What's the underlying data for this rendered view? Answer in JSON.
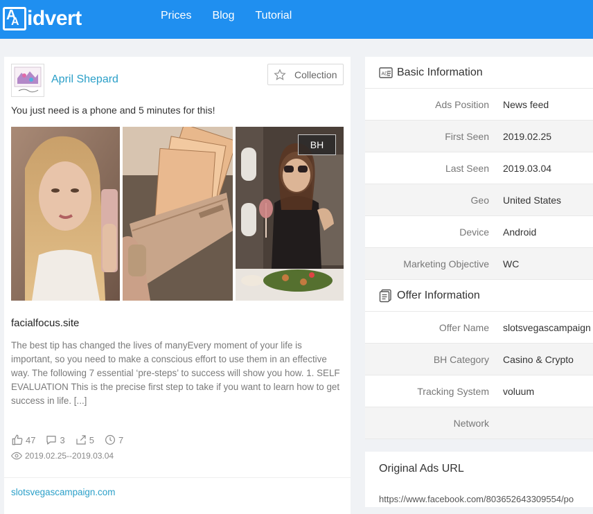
{
  "brand": {
    "logo_text": "idvert",
    "accent": "#1f8ff0",
    "link_color": "#2a9fc8"
  },
  "nav": {
    "items": [
      "Prices",
      "Blog",
      "Tutorial"
    ]
  },
  "ad": {
    "author": "April Shepard",
    "collection_label": "Collection",
    "caption": "You just need is a phone and 5 minutes for this!",
    "badge": "BH",
    "site": "facialfocus.site",
    "description": "The best tip has changed the lives of manyEvery moment of your life is important, so you need to make a conscious effort to use them in an effective way. The following 7 essential ‘pre-steps’ to success will show you how. 1. SELF EVALUATION This is the precise first step to take if you want to learn how to get success in life. [...]",
    "stats": {
      "likes": "47",
      "comments": "3",
      "shares": "5",
      "days": "7"
    },
    "date_range": "2019.02.25--2019.03.04",
    "link": "slotsvegascampaign.com"
  },
  "basic": {
    "title": "Basic Information",
    "rows": [
      {
        "k": "Ads Position",
        "v": "News feed"
      },
      {
        "k": "First Seen",
        "v": "2019.02.25"
      },
      {
        "k": "Last Seen",
        "v": "2019.03.04"
      },
      {
        "k": "Geo",
        "v": "United States"
      },
      {
        "k": "Device",
        "v": "Android"
      },
      {
        "k": "Marketing Objective",
        "v": "WC"
      }
    ]
  },
  "offer": {
    "title": "Offer Information",
    "rows": [
      {
        "k": "Offer Name",
        "v": "slotsvegascampaign"
      },
      {
        "k": "BH Category",
        "v": "Casino & Crypto"
      },
      {
        "k": "Tracking System",
        "v": "voluum"
      },
      {
        "k": "Network",
        "v": ""
      }
    ]
  },
  "url": {
    "title": "Original Ads URL",
    "value": "https://www.facebook.com/803652643309554/po"
  }
}
